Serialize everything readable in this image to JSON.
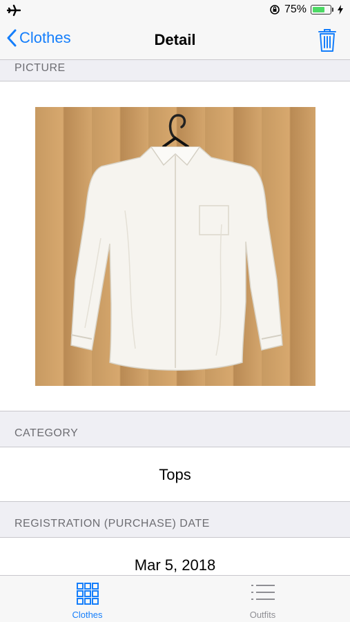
{
  "status_bar": {
    "battery_percent": "75%",
    "battery_level": 0.75
  },
  "nav": {
    "back_label": "Clothes",
    "title": "Detail"
  },
  "sections": {
    "picture": {
      "header": "PICTURE"
    },
    "category": {
      "header": "CATEGORY",
      "value": "Tops"
    },
    "registration": {
      "header": "REGISTRATION (PURCHASE) DATE",
      "value": "Mar 5, 2018"
    }
  },
  "tabs": [
    {
      "label": "Clothes",
      "icon": "grid-icon",
      "selected": true
    },
    {
      "label": "Outfits",
      "icon": "list-icon",
      "selected": false
    }
  ],
  "colors": {
    "accent": "#147efb",
    "inactive": "#8e8e93",
    "battery": "#4cd964"
  }
}
